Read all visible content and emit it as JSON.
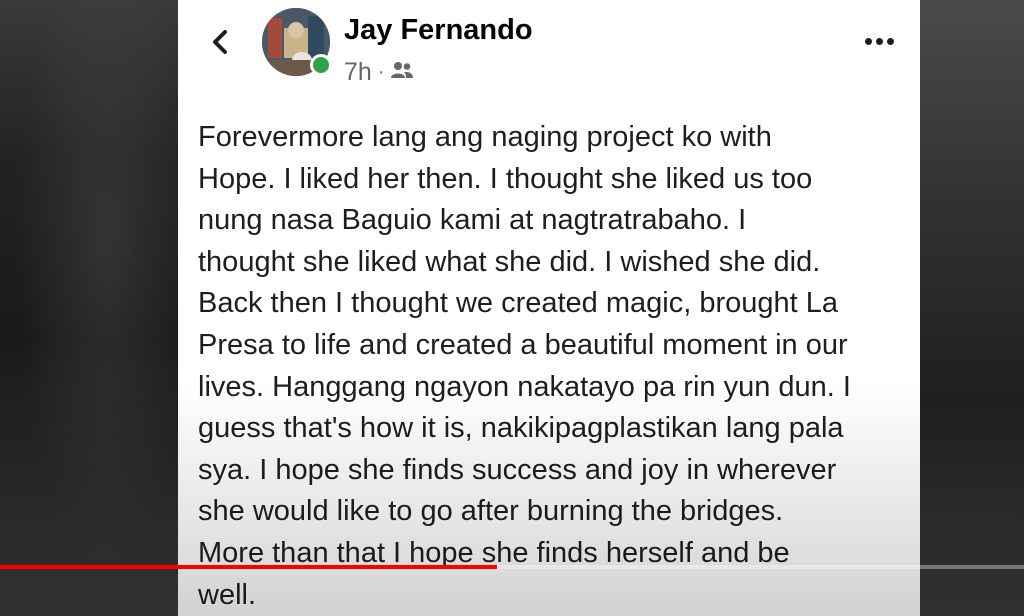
{
  "post": {
    "author": "Jay Fernando",
    "time": "7h",
    "separator": "·",
    "audience_icon": "friends-icon",
    "online": true,
    "text": "Forevermore lang ang naging project ko with\nHope. I liked her then. I thought she liked us too\nnung nasa Baguio kami at nagtratrabaho. I\nthought she liked what she did. I wished she did.\nBack then I thought we created magic, brought La\nPresa to life and created a beautiful moment in our\nlives. Hanggang ngayon nakatayo pa rin yun dun. I\nguess that's how it is, nakikipagplastikan lang pala\nsya. I hope she finds success and joy in wherever\nshe would like to go after burning the bridges.\nMore than that I hope she finds herself and be\nwell."
  },
  "icons": {
    "back": "chevron-left-icon",
    "more": "more-horizontal-icon"
  },
  "video": {
    "progress_fraction": 0.485,
    "progress_color": "#ff0000"
  },
  "colors": {
    "online": "#31a24c",
    "meta_text": "#65676b",
    "body_text": "#1c1e21"
  }
}
